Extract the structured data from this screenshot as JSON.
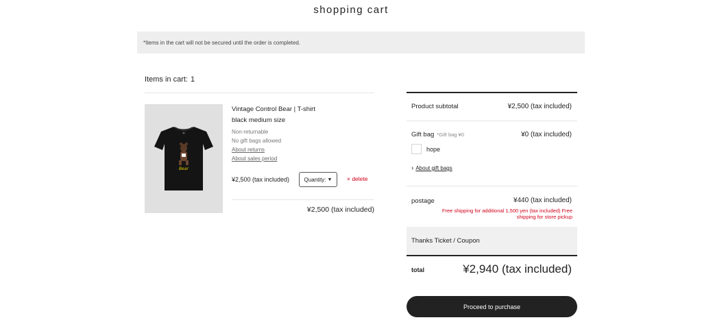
{
  "page": {
    "title": "shopping cart",
    "notice": "*Items in the cart will not be secured until the order is completed."
  },
  "cart": {
    "items_label": "Items in cart:",
    "items_count": "1",
    "item": {
      "name": "Vintage Control Bear | T-shirt",
      "variant": "black  medium size",
      "notes": [
        "Non-returnable",
        "No gift bags allowed"
      ],
      "links": [
        "About returns",
        "About sales period"
      ],
      "price": "¥2,500 (tax included)",
      "quantity_label": "Quantity:",
      "delete_label": "× delete",
      "line_total": "¥2,500 (tax included)",
      "image_icon": "tshirt-image",
      "image_caption": "Bear"
    }
  },
  "summary": {
    "subtotal_label": "Product subtotal",
    "subtotal_value": "¥2,500 (tax included)",
    "giftbag_label": "Gift bag",
    "giftbag_sub": "*Gift bag ¥0",
    "giftbag_value": "¥0 (tax included)",
    "giftbag_option": "hope",
    "about_giftbags": "About gift bags",
    "postage_label": "postage",
    "postage_value": "¥440 (tax included)",
    "postage_note": "Free shipping for additional 1,500 yen (tax included) Free shipping for store pickup",
    "coupon_label": "Thanks Ticket / Coupon",
    "total_label": "total",
    "total_value": "¥2,940 (tax included)"
  },
  "actions": {
    "proceed_label": "Proceed to purchase"
  },
  "colors": {
    "accent_red": "#d0021b",
    "button_dark": "#222222",
    "notice_bg": "#eeeeee"
  }
}
